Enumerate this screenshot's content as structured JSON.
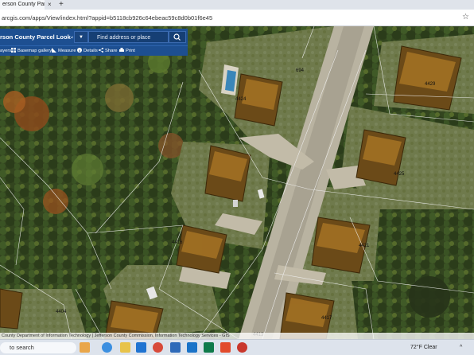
{
  "browser": {
    "tab_title": "erson County Parcel Look-u",
    "tab_close": "×",
    "new_tab": "+",
    "url": "arcgis.com/apps/View/index.html?appid=b5118cb926c64ebeac59c8d0b01f6e45",
    "bookmark_icon": "star-icon"
  },
  "app": {
    "title": "rson County Parcel Look-up",
    "search_placeholder": "Find address or place",
    "toolbar": {
      "layers": "ayers",
      "basemap": "Basemap gallery",
      "measure": "Measure",
      "details": "Details",
      "share": "Share",
      "print": "Print"
    },
    "accent_color": "#1d4f91"
  },
  "map": {
    "parcel_labels": [
      "694",
      "4429",
      "4424",
      "4425",
      "4421",
      "4416",
      "4404",
      "4417",
      "4413"
    ],
    "attribution": "County Department of Information Technology | Jefferson County Commission, Information Technology Services - GIS"
  },
  "taskbar": {
    "search_label": "to search",
    "weather_temp": "72°F",
    "weather_cond": "Clear",
    "tray_icon": "chevron-up-icon"
  }
}
